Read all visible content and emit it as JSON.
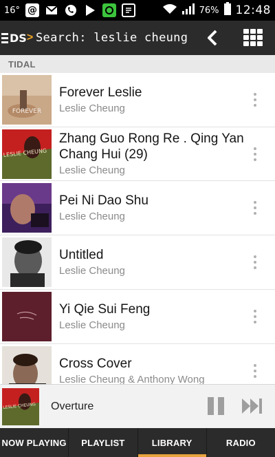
{
  "status_bar": {
    "temperature": "16°",
    "battery": "76%",
    "time": "12:48"
  },
  "app_bar": {
    "logo_text": "DS",
    "title": "Search: leslie cheung"
  },
  "section": {
    "label": "TIDAL"
  },
  "results": [
    {
      "title": "Forever Leslie",
      "artist": "Leslie Cheung",
      "art_text": "FOREVER"
    },
    {
      "title": "Zhang Guo Rong Re . Qing Yan Chang Hui (29)",
      "artist": "Leslie Cheung",
      "art_text": "LESLIE CHEUNG"
    },
    {
      "title": "Pei Ni Dao Shu",
      "artist": "Leslie Cheung"
    },
    {
      "title": "Untitled",
      "artist": "Leslie Cheung"
    },
    {
      "title": "Yi Qie Sui Feng",
      "artist": "Leslie Cheung"
    },
    {
      "title": "Cross Cover",
      "artist": "Leslie Cheung & Anthony Wong"
    }
  ],
  "now_playing": {
    "track": "Overture",
    "art_text": "LESLIE CHEUNG"
  },
  "tabs": [
    {
      "label": "NOW PLAYING",
      "active": false
    },
    {
      "label": "PLAYLIST",
      "active": false
    },
    {
      "label": "LIBRARY",
      "active": true
    },
    {
      "label": "RADIO",
      "active": false
    }
  ],
  "colors": {
    "app_bar": "#2b2b2b",
    "accent": "#e8a33d",
    "logo_arrow": "#f5a623"
  }
}
